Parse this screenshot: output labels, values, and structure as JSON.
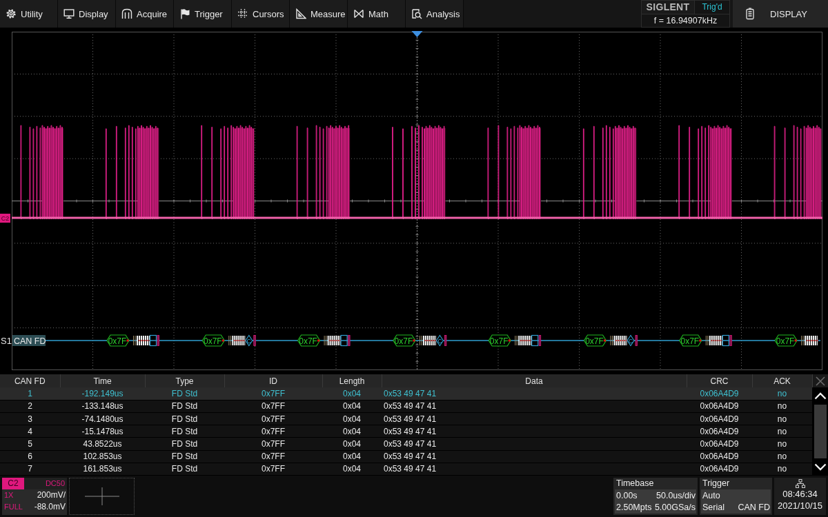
{
  "menu": [
    {
      "label": "Utility"
    },
    {
      "label": "Display"
    },
    {
      "label": "Acquire"
    },
    {
      "label": "Trigger"
    },
    {
      "label": "Cursors"
    },
    {
      "label": "Measure"
    },
    {
      "label": "Math"
    },
    {
      "label": "Analysis"
    }
  ],
  "status": {
    "brand": "SIGLENT",
    "trigger_state": "Trig'd",
    "frequency": "f = 16.94907kHz"
  },
  "display_button": {
    "label": "DISPLAY"
  },
  "screen": {
    "channel_marker": "C2",
    "bus": {
      "label": "S1",
      "protocol": "CAN FD",
      "frames": [
        {
          "id": "0x7F",
          "kind": "box"
        },
        {
          "id": "0x7F",
          "kind": "crc",
          "crc": "C"
        },
        {
          "id": "0x7F",
          "kind": "box"
        },
        {
          "id": "0x7F",
          "kind": "crc",
          "crc": "C"
        },
        {
          "id": "0x7F",
          "kind": "box"
        },
        {
          "id": "0x7F",
          "kind": "crc",
          "crc": "C"
        },
        {
          "id": "0x7F",
          "kind": "box"
        },
        {
          "id": "0x7F",
          "kind": "cut"
        }
      ]
    }
  },
  "table": {
    "columns": [
      "CAN FD",
      "Time",
      "Type",
      "ID",
      "Length",
      "Data",
      "CRC",
      "ACK"
    ],
    "rows": [
      {
        "selected": true,
        "cells": [
          "1",
          "-192.149us",
          "FD Std",
          "0x7FF",
          "0x04",
          "0x53 49 47 41",
          "0x06A4D9",
          "no"
        ]
      },
      {
        "selected": false,
        "cells": [
          "2",
          "-133.148us",
          "FD Std",
          "0x7FF",
          "0x04",
          "0x53 49 47 41",
          "0x06A4D9",
          "no"
        ]
      },
      {
        "selected": false,
        "cells": [
          "3",
          "-74.1480us",
          "FD Std",
          "0x7FF",
          "0x04",
          "0x53 49 47 41",
          "0x06A4D9",
          "no"
        ]
      },
      {
        "selected": false,
        "cells": [
          "4",
          "-15.1478us",
          "FD Std",
          "0x7FF",
          "0x04",
          "0x53 49 47 41",
          "0x06A4D9",
          "no"
        ]
      },
      {
        "selected": false,
        "cells": [
          "5",
          "43.8522us",
          "FD Std",
          "0x7FF",
          "0x04",
          "0x53 49 47 41",
          "0x06A4D9",
          "no"
        ]
      },
      {
        "selected": false,
        "cells": [
          "6",
          "102.853us",
          "FD Std",
          "0x7FF",
          "0x04",
          "0x53 49 47 41",
          "0x06A4D9",
          "no"
        ]
      },
      {
        "selected": false,
        "cells": [
          "7",
          "161.853us",
          "FD Std",
          "0x7FF",
          "0x04",
          "0x53 49 47 41",
          "0x06A4D9",
          "no"
        ]
      }
    ]
  },
  "channel": {
    "name": "C2",
    "coupling": "DC50",
    "probe": "1X",
    "scale": "200mV/",
    "bandwidth": "FULL",
    "offset": "-88.0mV"
  },
  "timebase": {
    "title": "Timebase",
    "delay": "0.00s",
    "scale": "50.0us/div",
    "memory": "2.50Mpts",
    "sample_rate": "5.00GSa/s"
  },
  "trigger": {
    "title": "Trigger",
    "mode": "Auto",
    "type": "Serial",
    "source": "CAN FD"
  },
  "clock": {
    "time": "08:46:34",
    "date": "2021/10/15"
  }
}
